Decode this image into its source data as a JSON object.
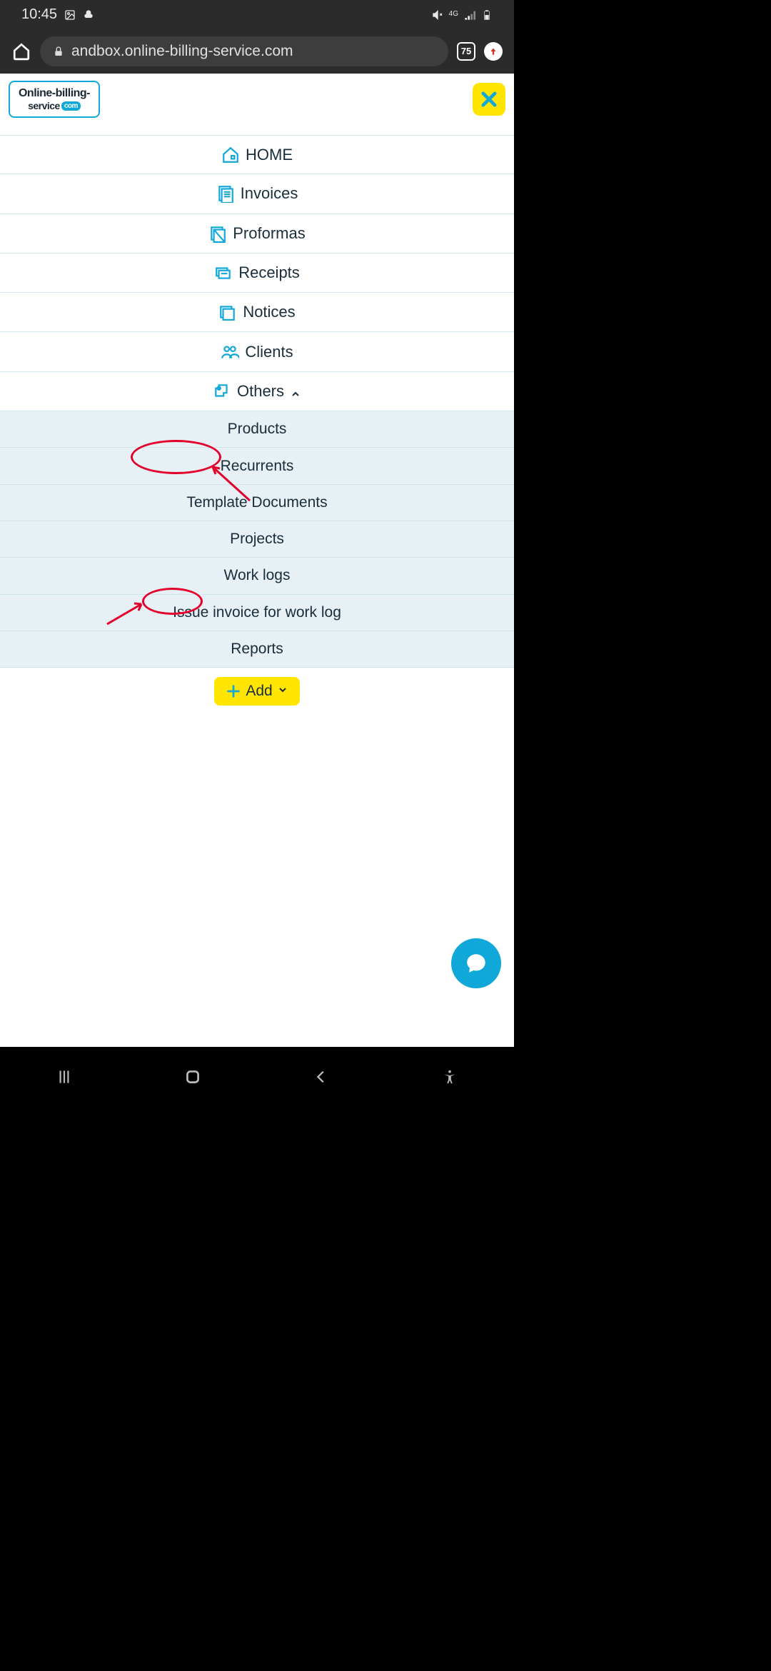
{
  "status": {
    "time": "10:45",
    "network_label": "4G",
    "tab_count": "75"
  },
  "browser": {
    "url_display": "andbox.online-billing-service.com"
  },
  "logo": {
    "line1": "Online-billing-",
    "line2": "service",
    "badge": "com"
  },
  "menu": [
    {
      "label": "HOME",
      "icon": "home"
    },
    {
      "label": "Invoices",
      "icon": "invoices"
    },
    {
      "label": "Proformas",
      "icon": "proformas"
    },
    {
      "label": "Receipts",
      "icon": "receipts"
    },
    {
      "label": "Notices",
      "icon": "notices"
    },
    {
      "label": "Clients",
      "icon": "clients"
    },
    {
      "label": "Others",
      "icon": "others",
      "expanded": true
    }
  ],
  "submenu": [
    "Products",
    "Recurrents",
    "Template Documents",
    "Projects",
    "Work logs",
    "Issue invoice for work log",
    "Reports"
  ],
  "add_button": "Add"
}
